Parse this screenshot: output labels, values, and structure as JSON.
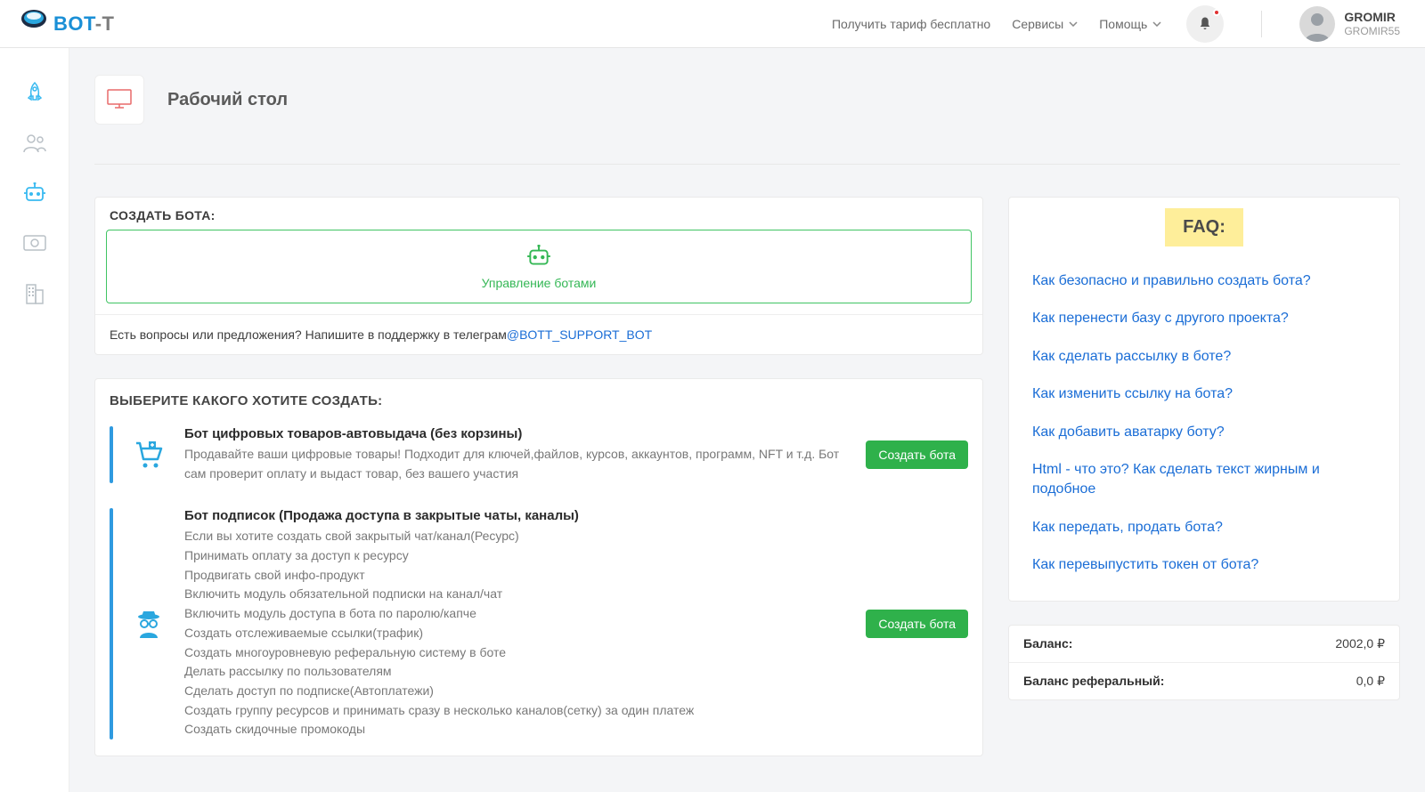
{
  "header": {
    "logo_text_main": "BOT",
    "logo_text_suffix": "-T",
    "links": {
      "free_plan": "Получить тариф бесплатно",
      "services": "Сервисы",
      "help": "Помощь"
    },
    "user": {
      "name": "GROMIR",
      "handle": "GROMIR55"
    }
  },
  "page": {
    "title": "Рабочий стол"
  },
  "create_bot": {
    "title": "СОЗДАТЬ БОТА:",
    "manage_label": "Управление ботами",
    "support_prefix": "Есть вопросы или предложения? Напишите в поддержку в телеграм",
    "support_link": "@BOTT_SUPPORT_BOT"
  },
  "choose": {
    "title": "ВЫБЕРИТЕ КАКОГО ХОТИТЕ СОЗДАТЬ:",
    "create_button": "Создать бота",
    "type1": {
      "title": "Бот цифровых товаров-автовыдача (без корзины)",
      "desc": "Продавайте ваши цифровые товары! Подходит для ключей,файлов, курсов, аккаунтов, программ, NFT и т.д. Бот сам проверит оплату и выдаст товар, без вашего участия"
    },
    "type2": {
      "title": "Бот подписок (Продажа доступа в закрытые чаты, каналы)",
      "lines": [
        "Если вы хотите создать свой закрытый чат/канал(Ресурс)",
        "Принимать оплату за доступ к ресурсу",
        "Продвигать свой инфо-продукт",
        "Включить модуль обязательной подписки на канал/чат",
        "Включить модуль доступа в бота по паролю/капче",
        "Создать отслеживаемые ссылки(трафик)",
        "Создать многоуровневую реферальную систему в боте",
        "Делать рассылку по пользователям",
        "Сделать доступ по подписке(Автоплатежи)",
        "Создать группу ресурсов и принимать сразу в несколько каналов(сетку) за один платеж",
        "Создать скидочные промокоды"
      ]
    }
  },
  "faq": {
    "badge": "FAQ:",
    "items": [
      "Как безопасно и правильно создать бота?",
      "Как перенести базу с другого проекта?",
      "Как сделать рассылку в боте?",
      "Как изменить ссылку на бота?",
      "Как добавить аватарку боту?",
      "Html - что это? Как сделать текст жирным и подобное",
      "Как передать, продать бота?",
      "Как перевыпустить токен от бота?"
    ]
  },
  "balance": {
    "rows": [
      {
        "label": "Баланс:",
        "value": "2002,0 ₽"
      },
      {
        "label": "Баланс реферальный:",
        "value": "0,0 ₽"
      }
    ]
  }
}
